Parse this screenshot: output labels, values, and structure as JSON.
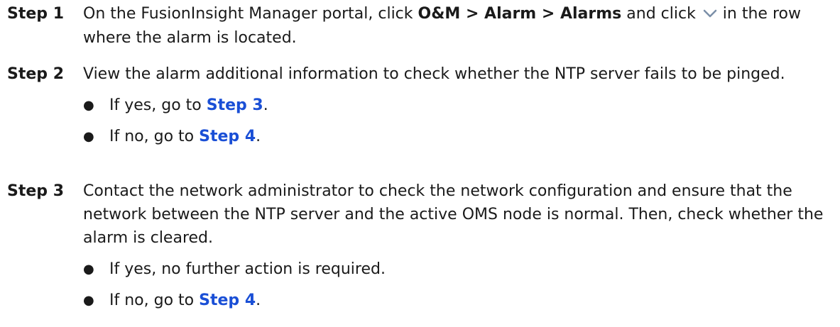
{
  "steps": [
    {
      "label": "Step 1",
      "text": {
        "t1": "On the FusionInsight Manager portal, click ",
        "path": "O&M > Alarm > Alarms",
        "t2": " and click ",
        "icon": "chevron-down-icon",
        "t3": " in the row where the alarm is located."
      }
    },
    {
      "label": "Step 2",
      "text": "View the alarm additional information to check whether the NTP server fails to be pinged.",
      "bullets": [
        {
          "bullet": "●",
          "pre": "If yes, go to ",
          "link": "Step 3",
          "post": "."
        },
        {
          "bullet": "●",
          "pre": "If no, go to ",
          "link": "Step 4",
          "post": "."
        }
      ]
    },
    {
      "label": "Step 3",
      "text": "Contact the network administrator to check the network configuration and ensure that the network between the NTP server and the active OMS node is normal. Then, check whether the alarm is cleared.",
      "bullets": [
        {
          "bullet": "●",
          "text": "If yes, no further action is required."
        },
        {
          "bullet": "●",
          "pre": "If no, go to ",
          "link": "Step 4",
          "post": "."
        }
      ]
    }
  ],
  "colors": {
    "link": "#1a4fd6",
    "icon": "#7b8fa8"
  }
}
